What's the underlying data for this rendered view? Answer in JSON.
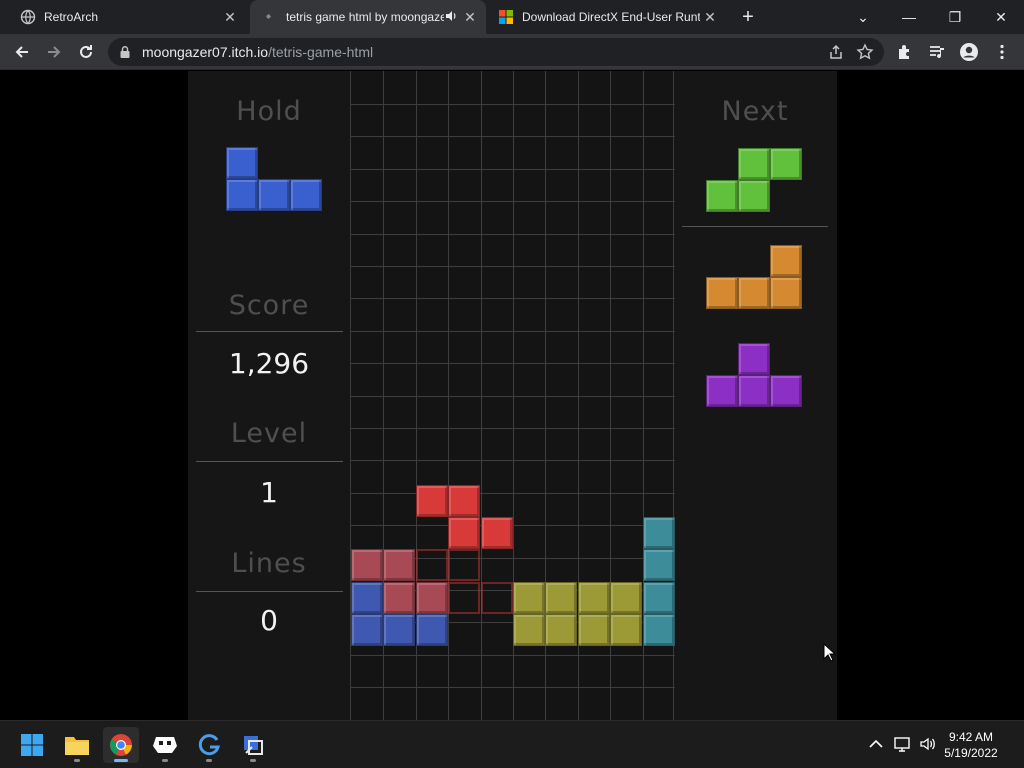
{
  "browser": {
    "tabs": [
      {
        "title": "RetroArch",
        "active": false
      },
      {
        "title": "tetris game html by moongaze",
        "active": true
      },
      {
        "title": "Download DirectX End-User Runt",
        "active": false
      }
    ],
    "close_glyph": "✕",
    "new_tab_glyph": "+",
    "url_domain": "moongazer07.itch.io",
    "url_path": "/tetris-game-html",
    "window_controls": [
      "⌄",
      "—",
      "❐",
      "✕"
    ]
  },
  "game": {
    "hold_label": "Hold",
    "next_label": "Next",
    "score_label": "Score",
    "score_value": "1,296",
    "level_label": "Level",
    "level_value": "1",
    "lines_label": "Lines",
    "lines_value": "0",
    "colors": {
      "I": "#3d9cab",
      "J": "#3a5fcf",
      "L": "#d58a31",
      "O": "#bcb83a",
      "S": "#62c13c",
      "T": "#8c2fc4",
      "Z": "#d83a3a",
      "board_blue": "#3f58b0",
      "board_red": "#a84a55",
      "board_yellow": "#9c9a36",
      "board_teal": "#3d8c99"
    },
    "hold_piece": "J",
    "next_pieces": [
      "S",
      "L",
      "T"
    ]
  },
  "taskbar": {
    "apps": [
      "start-icon",
      "file-explorer-icon",
      "chrome-icon",
      "retroarch-icon",
      "app-g-icon",
      "app-tools-icon"
    ],
    "time": "9:42 AM",
    "date": "5/19/2022"
  }
}
